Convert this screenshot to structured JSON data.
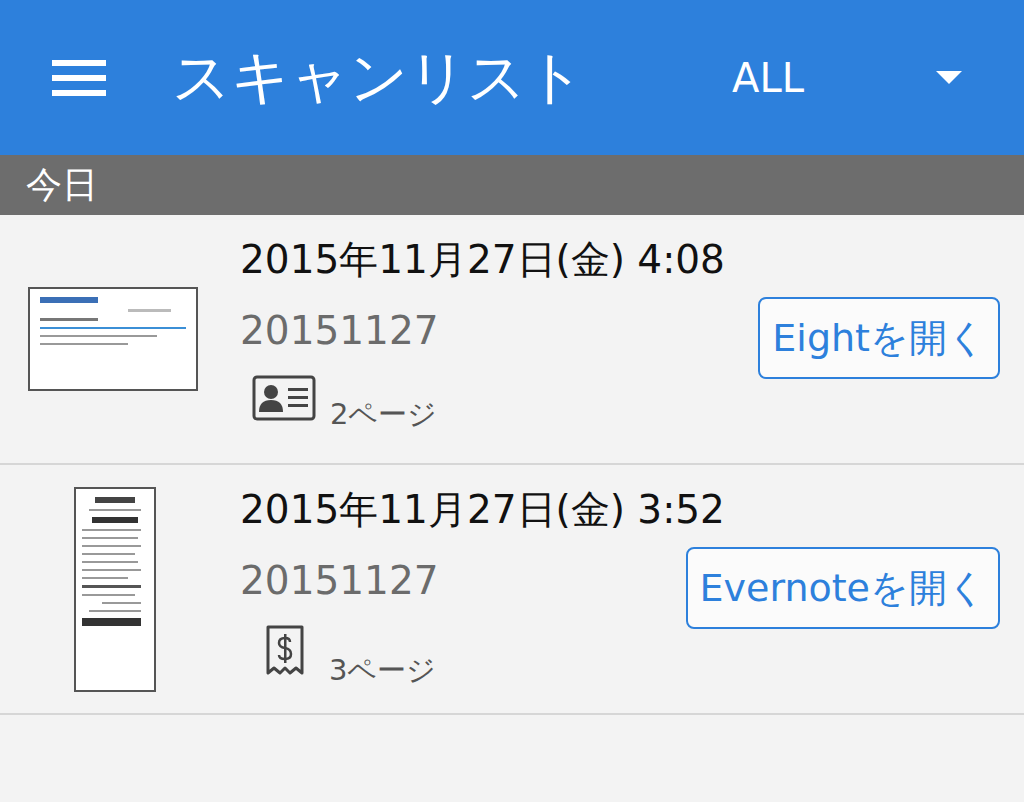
{
  "header": {
    "title": "スキャンリスト",
    "filter": "ALL"
  },
  "section": {
    "label": "今日"
  },
  "items": [
    {
      "kind": "card",
      "datetime": "2015年11月27日(金) 4:08",
      "name": "20151127",
      "pages": "2ページ",
      "action": "Eightを開く"
    },
    {
      "kind": "receipt",
      "datetime": "2015年11月27日(金) 3:52",
      "name": "20151127",
      "pages": "3ページ",
      "action": "Evernoteを開く"
    }
  ]
}
